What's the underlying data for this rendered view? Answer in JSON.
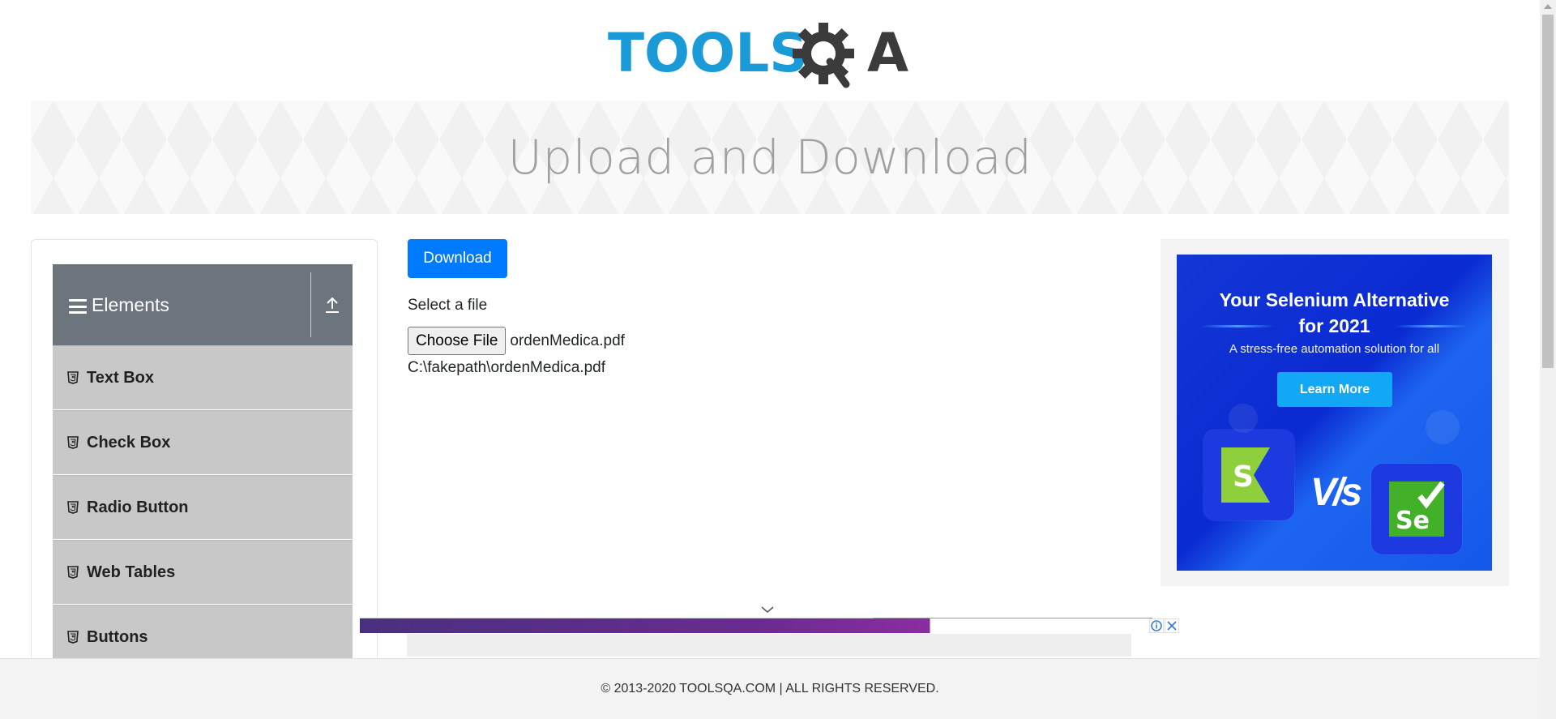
{
  "brand": {
    "logo_text_left": "TOOLS",
    "logo_text_right": "A"
  },
  "page": {
    "title": "Upload and Download"
  },
  "sidebar": {
    "group": {
      "label": "Elements"
    },
    "items": [
      {
        "label": "Text Box"
      },
      {
        "label": "Check Box"
      },
      {
        "label": "Radio Button"
      },
      {
        "label": "Web Tables"
      },
      {
        "label": "Buttons"
      }
    ]
  },
  "main": {
    "download_label": "Download",
    "select_label": "Select a file",
    "choose_file_label": "Choose File",
    "chosen_file_name": "ordenMedica.pdf",
    "uploaded_path": "C:\\fakepath\\ordenMedica.pdf"
  },
  "ad": {
    "title_line1": "Your Selenium Alternative",
    "title_line2": "for 2021",
    "subtitle": "A stress-free automation solution for all",
    "cta": "Learn More",
    "vs": "V/s",
    "left_logo": "S",
    "right_logo": "Se"
  },
  "footer": {
    "text": "© 2013-2020 TOOLSQA.COM | ALL RIGHTS RESERVED."
  },
  "colors": {
    "primary": "#007bff",
    "sidebar_header": "#6c757d",
    "menu_item": "#c8c8c8",
    "logo_blue": "#1a9ad6",
    "logo_dark": "#3b3b3b"
  }
}
